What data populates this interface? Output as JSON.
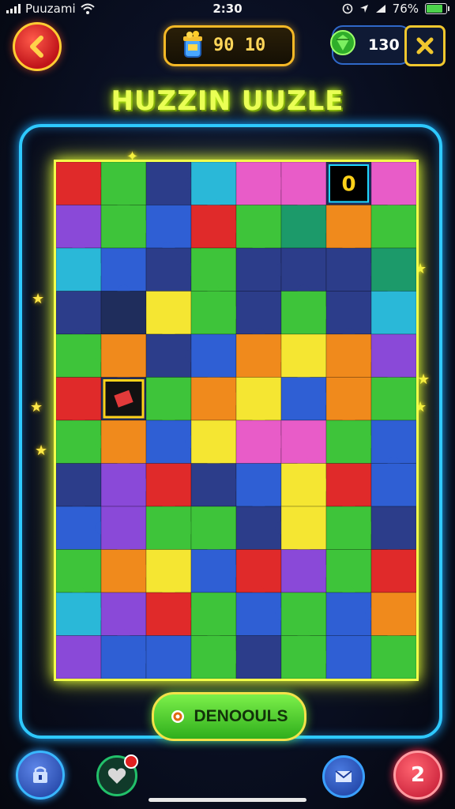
{
  "status_bar": {
    "carrier": "Puuzami",
    "time": "2:30",
    "battery": "76%",
    "battery_level": 0.76
  },
  "top_bar": {
    "coins": "90 10",
    "gems": "130"
  },
  "title": "HUZZIN UUZLE",
  "board": {
    "highlight_number": "0",
    "rows": 12,
    "cols": 8,
    "colors": {
      "green": "#3ec43a",
      "blue": "#2f5fd4",
      "navy": "#2c3d8a",
      "yellow": "#f5e632",
      "orange": "#f08a1c",
      "purple": "#8a49d8",
      "red": "#e02a2a",
      "pink": "#e85cc8",
      "cyan": "#2ab8d8",
      "dark": "#1f2d5c",
      "teal": "#1c9a6a",
      "lime": "#8fe03a"
    }
  },
  "action_button": {
    "label": "DENOOULS"
  },
  "bottom_bar": {
    "buttons": [
      "shop",
      "lives",
      "mail",
      "level"
    ],
    "level_label": "2"
  },
  "accent_colors": {
    "frame": "#2ec9ff",
    "board_glow": "#f3ff4a",
    "title": "#eaff55"
  }
}
